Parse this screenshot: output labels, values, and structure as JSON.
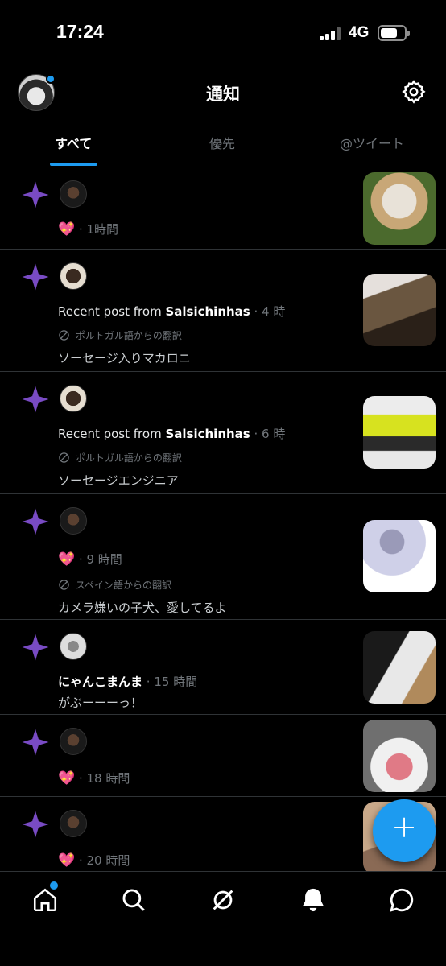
{
  "status_bar": {
    "time": "17:24",
    "network": "4G"
  },
  "header": {
    "title": "通知",
    "profile_icon": "avatar",
    "settings_icon": "gear-icon"
  },
  "tabs": [
    {
      "label": "すべて",
      "active": true
    },
    {
      "label": "優先",
      "active": false
    },
    {
      "label": "@ツイート",
      "active": false
    }
  ],
  "notifications": [
    {
      "type": "like",
      "heart": "💖",
      "meta": "· 1時間",
      "thumb_colors": [
        "#4b6a2d",
        "#c8a777"
      ]
    },
    {
      "type": "post",
      "prefix": "Recent post from",
      "user": "Salsichinhas",
      "meta": "· 4 時",
      "translate": "ポルトガル語からの翻訳",
      "text": "ソーセージ入りマカロニ",
      "thumb_colors": [
        "#6a5640",
        "#e5e0dc"
      ]
    },
    {
      "type": "post",
      "prefix": "Recent post from",
      "user": "Salsichinhas",
      "meta": "· 6 時",
      "translate": "ポルトガル語からの翻訳",
      "text": "ソーセージエンジニア",
      "thumb_colors": [
        "#e8e8e8",
        "#d7e21f"
      ]
    },
    {
      "type": "like_text",
      "heart": "💖",
      "meta": "· 9 時間",
      "translate": "スペイン語からの翻訳",
      "text": "カメラ嫌いの子犬、愛してるよ",
      "thumb_colors": [
        "#cfd0e8",
        "#ffffff"
      ]
    },
    {
      "type": "user_post",
      "user": "にゃんこまんま",
      "meta": "· 15 時間",
      "text": "がぶーーーっ！",
      "thumb_colors": [
        "#b08a5c",
        "#e8e8e8"
      ]
    },
    {
      "type": "like",
      "heart": "💖",
      "meta": "· 18 時間",
      "thumb_colors": [
        "#6f6f6f",
        "#e07a86"
      ]
    },
    {
      "type": "like",
      "heart": "💖",
      "meta": "· 20 時間",
      "thumb_colors": [
        "#8a6a55",
        "#c9a98a"
      ]
    }
  ],
  "fab": {
    "label": "+"
  },
  "colors": {
    "accent": "#1d9bf0",
    "sparkle": "#794bc4",
    "divider": "#2f3336"
  },
  "nav": [
    "home-icon",
    "search-icon",
    "spaces-icon",
    "notifications-icon",
    "messages-icon"
  ]
}
